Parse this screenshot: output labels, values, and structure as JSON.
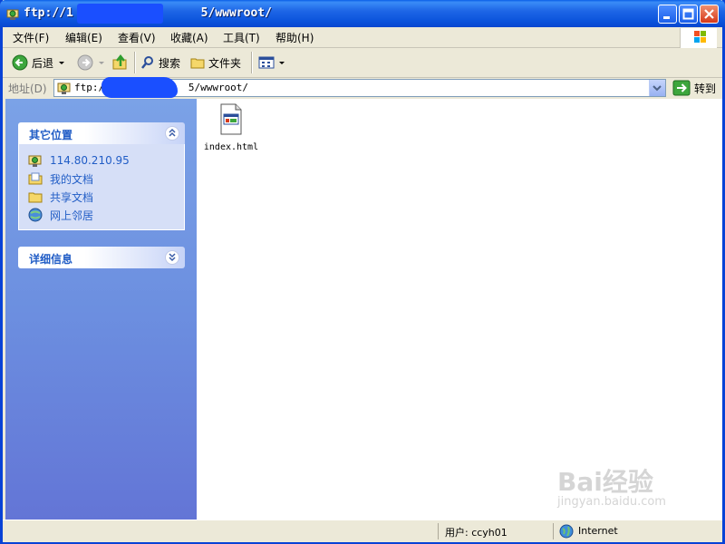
{
  "window": {
    "title": "ftp://1                  5/wwwroot/"
  },
  "menu": [
    {
      "label": "文件(F)"
    },
    {
      "label": "编辑(E)"
    },
    {
      "label": "查看(V)"
    },
    {
      "label": "收藏(A)"
    },
    {
      "label": "工具(T)"
    },
    {
      "label": "帮助(H)"
    }
  ],
  "toolbar": {
    "back_label": "后退",
    "search_label": "搜索",
    "folders_label": "文件夹"
  },
  "address": {
    "label": "地址(D)",
    "value": "ftp:/              5/wwwroot/",
    "go_label": "转到"
  },
  "left_pane": {
    "other_places": {
      "title": "其它位置",
      "items": [
        {
          "label": "114.80.210.95",
          "icon": "ftp-server-icon"
        },
        {
          "label": "我的文档",
          "icon": "my-documents-icon"
        },
        {
          "label": "共享文档",
          "icon": "shared-folder-icon"
        },
        {
          "label": "网上邻居",
          "icon": "network-icon"
        }
      ]
    },
    "details": {
      "title": "详细信息"
    }
  },
  "files": [
    {
      "name": "index.html",
      "icon": "html-file-icon"
    }
  ],
  "status": {
    "user": "用户: ccyh01",
    "zone": "Internet"
  },
  "watermark": {
    "brand": "Bai经验",
    "url": "jingyan.baidu.com"
  }
}
